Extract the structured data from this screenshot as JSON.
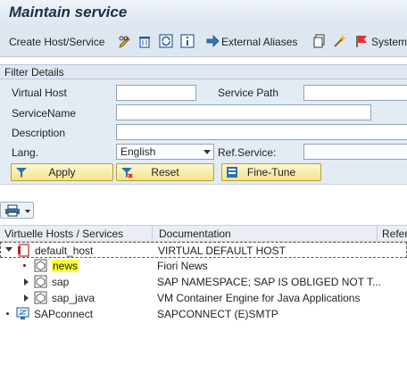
{
  "window": {
    "title": "Maintain service"
  },
  "toolbar": {
    "create_label": "Create Host/Service",
    "external_aliases_label": "External Aliases",
    "system_label": "System"
  },
  "filter": {
    "header": "Filter Details",
    "virtual_host_label": "Virtual Host",
    "virtual_host_value": "",
    "service_path_label": "Service Path",
    "service_path_value": "",
    "service_name_label": "ServiceName",
    "service_name_value": "",
    "description_label": "Description",
    "description_value": "",
    "lang_label": "Lang.",
    "lang_value": "English",
    "ref_service_label": "Ref.Service:",
    "ref_service_value": "",
    "apply_label": "Apply",
    "reset_label": "Reset",
    "finetune_label": "Fine-Tune"
  },
  "table": {
    "columns": [
      "Virtuelle Hosts / Services",
      "Documentation",
      "Refere"
    ],
    "rows": [
      {
        "name": "default_host",
        "doc": "VIRTUAL DEFAULT HOST"
      },
      {
        "name": "news",
        "doc": "Fiori News"
      },
      {
        "name": "sap",
        "doc": "SAP NAMESPACE; SAP IS OBLIGED NOT T..."
      },
      {
        "name": "sap_java",
        "doc": "VM Container Engine for Java Applications"
      },
      {
        "name": "SAPconnect",
        "doc": "SAPCONNECT (E)SMTP"
      }
    ]
  },
  "icons": {
    "pencil": "pencil-glasses-icon",
    "delete": "trash-icon",
    "refresh": "refresh-icon",
    "info": "info-icon",
    "arrow": "arrow-right-icon",
    "copy": "copy-icon",
    "wand": "magic-wand-icon",
    "flag": "flag-icon"
  },
  "colors": {
    "title_bg": "#e6eef6",
    "toolbar_bg": "#dee7f0",
    "filter_bg": "#e4ecf3",
    "button_yellow": "#f7e99a",
    "highlight": "#ffff33"
  }
}
